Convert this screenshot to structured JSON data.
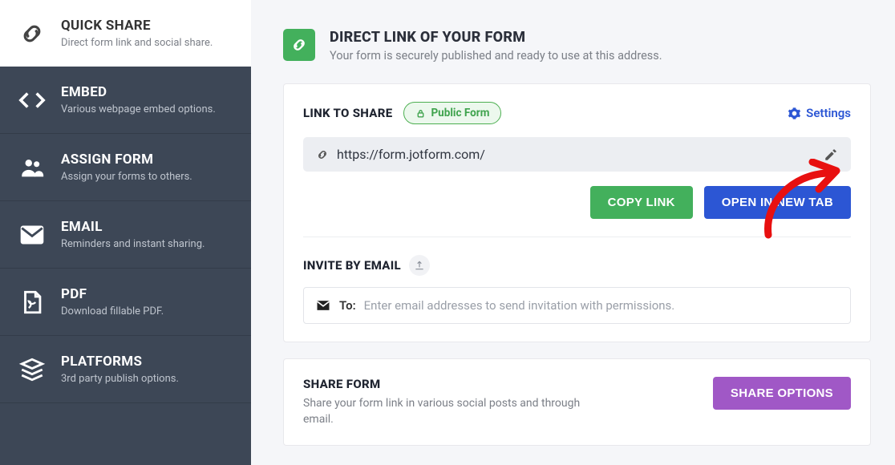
{
  "sidebar": {
    "items": [
      {
        "title": "QUICK SHARE",
        "sub": "Direct form link and social share."
      },
      {
        "title": "EMBED",
        "sub": "Various webpage embed options."
      },
      {
        "title": "ASSIGN FORM",
        "sub": "Assign your forms to others."
      },
      {
        "title": "EMAIL",
        "sub": "Reminders and instant sharing."
      },
      {
        "title": "PDF",
        "sub": "Download fillable PDF."
      },
      {
        "title": "PLATFORMS",
        "sub": "3rd party publish options."
      }
    ]
  },
  "header": {
    "title": "DIRECT LINK OF YOUR FORM",
    "sub": "Your form is securely published and ready to use at this address."
  },
  "link_section": {
    "label": "LINK TO SHARE",
    "badge": "Public Form",
    "settings": "Settings",
    "url": "https://form.jotform.com/",
    "copy": "COPY LINK",
    "open": "OPEN IN NEW TAB"
  },
  "invite_section": {
    "label": "INVITE BY EMAIL",
    "to": "To:",
    "placeholder": "Enter email addresses to send invitation with permissions."
  },
  "share_section": {
    "label": "SHARE FORM",
    "sub": "Share your form link in various social posts and through email.",
    "button": "SHARE OPTIONS"
  }
}
